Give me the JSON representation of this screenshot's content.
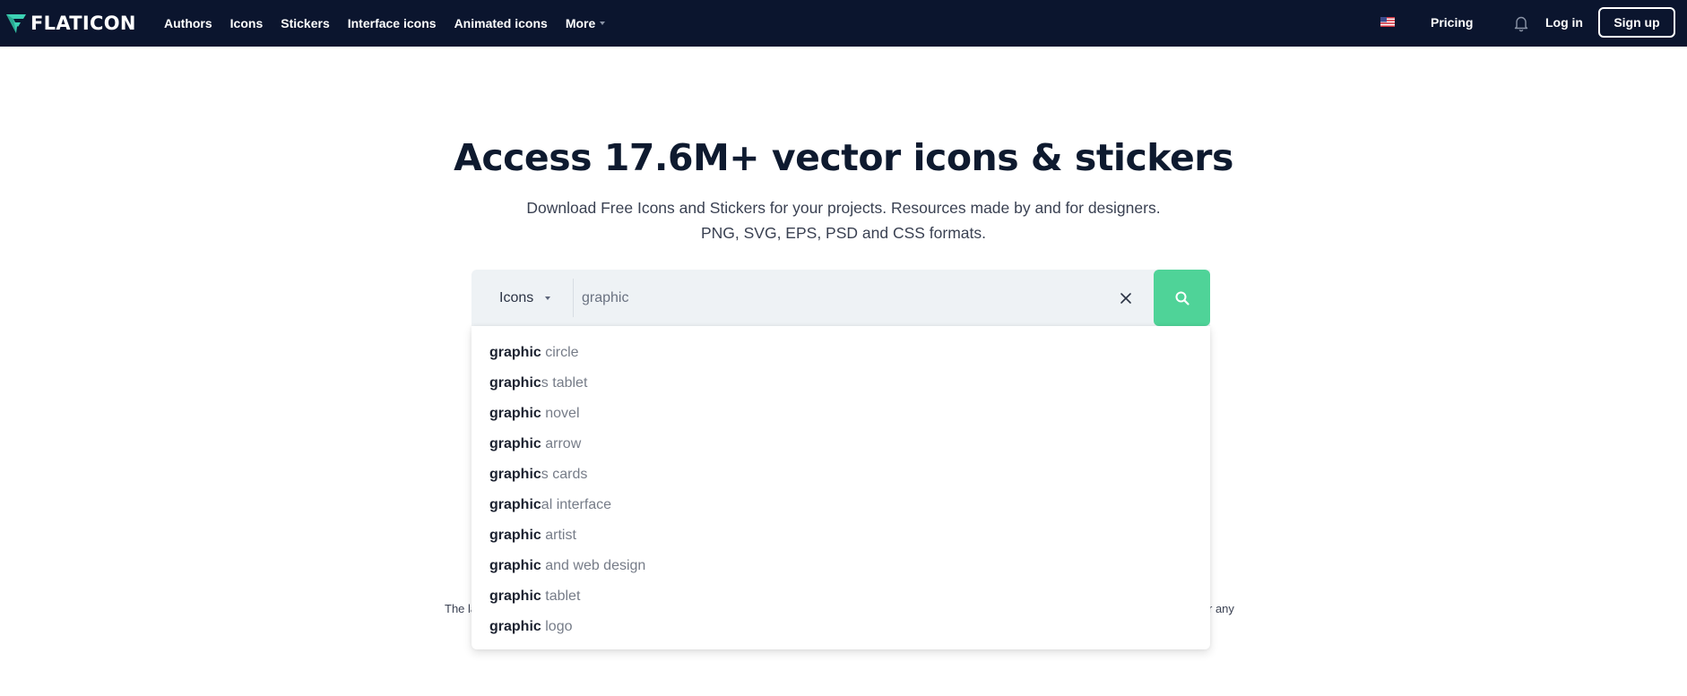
{
  "header": {
    "logo_text": "FLATICON",
    "nav": [
      {
        "label": "Authors"
      },
      {
        "label": "Icons"
      },
      {
        "label": "Stickers"
      },
      {
        "label": "Interface icons"
      },
      {
        "label": "Animated icons"
      },
      {
        "label": "More"
      }
    ],
    "language_icon": "us-flag-icon",
    "pricing_label": "Pricing",
    "notifications_icon": "bell-icon",
    "login_label": "Log in",
    "signup_label": "Sign up",
    "colors": {
      "background": "#0b152e",
      "logo_accent": "#3cd1b4"
    }
  },
  "hero": {
    "title": "Access 17.6M+ vector icons & stickers",
    "subtitle_line1": "Download Free Icons and Stickers for your projects. Resources made by and for designers.",
    "subtitle_line2": "PNG, SVG, EPS, PSD and CSS formats."
  },
  "search": {
    "type_selected": "Icons",
    "query": "graphic",
    "clear_icon": "close-icon",
    "submit_icon": "search-icon",
    "button_color": "#4fd398"
  },
  "suggestions": [
    {
      "match": "graphic",
      "rest": " circle"
    },
    {
      "match": "graphic",
      "rest": "s tablet"
    },
    {
      "match": "graphic",
      "rest": " novel"
    },
    {
      "match": "graphic",
      "rest": " arrow"
    },
    {
      "match": "graphic",
      "rest": "s cards"
    },
    {
      "match": "graphic",
      "rest": "al interface"
    },
    {
      "match": "graphic",
      "rest": " artist"
    },
    {
      "match": "graphic",
      "rest": " and web design"
    },
    {
      "match": "graphic",
      "rest": " tablet"
    },
    {
      "match": "graphic",
      "rest": " logo"
    }
  ],
  "background_text": {
    "left_fragment": "The la",
    "right_fragment": "r any"
  }
}
